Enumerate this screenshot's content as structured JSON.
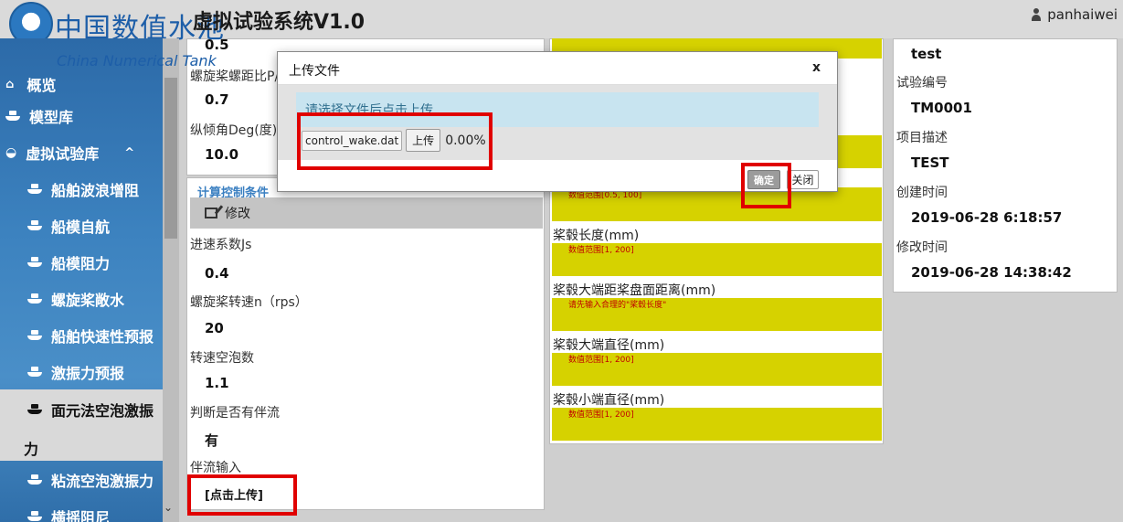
{
  "header": {
    "logo_zh": "中国数值水池",
    "logo_en": "China Numerical Tank",
    "app_title": "虚拟试验系统V1.0",
    "username": "panhaiwei"
  },
  "sidebar": {
    "items": [
      {
        "label": "概览"
      },
      {
        "label": "模型库"
      },
      {
        "label": "虚拟试验库",
        "toggle": "^"
      },
      {
        "label": "船舶波浪增阻"
      },
      {
        "label": "船模自航"
      },
      {
        "label": "船模阻力"
      },
      {
        "label": "螺旋桨敞水"
      },
      {
        "label": "船舶快速性预报"
      },
      {
        "label": "激振力预报"
      },
      {
        "label": "面元法空泡激振"
      },
      {
        "label": "力"
      },
      {
        "label": "粘流空泡激振力"
      },
      {
        "label": "横摇阻尼"
      }
    ],
    "scroll_down_glyph": "⌄"
  },
  "params": {
    "top_value": "0.5",
    "pitch_label": "螺旋桨螺距比P/D",
    "pitch_value": "0.7",
    "trim_label": "纵倾角Deg(度)",
    "trim_value": "10.0",
    "section_tab": "计算控制条件",
    "edit_label": "修改",
    "advance_label": "进速系数Js",
    "advance_value": "0.4",
    "rps_label": "螺旋桨转速n（rps）",
    "rps_value": "20",
    "cavitation_label": "转速空泡数",
    "cavitation_value": "1.1",
    "wake_flag_label": "判断是否有伴流",
    "wake_flag_value": "有",
    "wake_input_label": "伴流输入",
    "wake_upload_link": "[点击上传]"
  },
  "hub_fields": {
    "hint_top": "数值范围[0.5, 100]",
    "hub_length_label": "桨毂长度(mm)",
    "hub_length_hint": "数值范围[1, 200]",
    "hub_dist_label": "桨毂大端距桨盘面距离(mm)",
    "hub_dist_hint": "请先输入合理的\"桨毂长度\"",
    "hub_big_label": "桨毂大端直径(mm)",
    "hub_big_hint": "数值范围[1, 200]",
    "hub_small_label": "桨毂小端直径(mm)",
    "hub_small_hint": "数值范围[1, 200]"
  },
  "info_panel": {
    "name_value": "test",
    "test_no_label": "试验编号",
    "test_no_value": "TM0001",
    "desc_label": "项目描述",
    "desc_value": "TEST",
    "created_label": "创建时间",
    "created_value": "2019-06-28 6:18:57",
    "modified_label": "修改时间",
    "modified_value": "2019-06-28 14:38:42"
  },
  "dialog": {
    "title": "上传文件",
    "close": "x",
    "info": "请选择文件后点击上传",
    "file_name": "control_wake.dat",
    "upload_label": "上传",
    "progress": "0.00%",
    "ok_label": "确定",
    "cancel_label": "关闭"
  },
  "colors": {
    "sidebar_blue": "#3c82bf",
    "field_yellow": "#d6d200",
    "highlight_red": "#e00000",
    "info_bar": "#c8e4f0"
  }
}
